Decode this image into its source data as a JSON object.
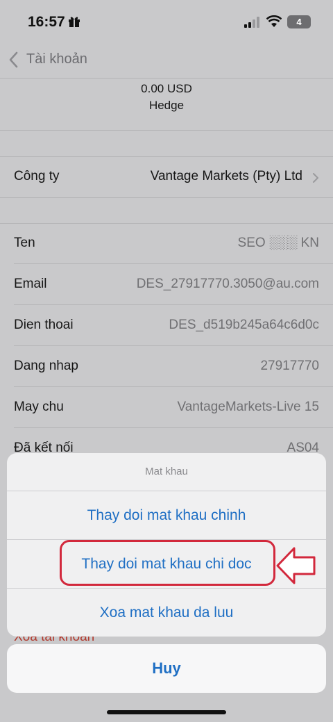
{
  "status_bar": {
    "time": "16:57",
    "battery": "4"
  },
  "nav": {
    "back_label": "Tài khoản"
  },
  "balance": {
    "amount": "0.00 USD",
    "mode": "Hedge"
  },
  "company": {
    "label": "Công ty",
    "value": "Vantage Markets (Pty) Ltd"
  },
  "details": [
    {
      "label": "Ten",
      "value": "SEO ░░░ KN"
    },
    {
      "label": "Email",
      "value": "DES_27917770.3050@au.com"
    },
    {
      "label": "Dien thoai",
      "value": "DES_d519b245a64c6d0c"
    },
    {
      "label": "Dang nhap",
      "value": "27917770"
    },
    {
      "label": "May chu",
      "value": "VantageMarkets-Live 15"
    },
    {
      "label": "Đã kết nối",
      "value": "AS04"
    }
  ],
  "hidden_row": {
    "label": "Xoa tai khoản"
  },
  "action_sheet": {
    "title": "Mat khau",
    "options": [
      "Thay doi mat khau chinh",
      "Thay doi mat khau chi doc",
      "Xoa mat khau da luu"
    ],
    "cancel": "Huy"
  },
  "colors": {
    "accent": "#1f6fc4",
    "highlight": "#d2283c"
  }
}
